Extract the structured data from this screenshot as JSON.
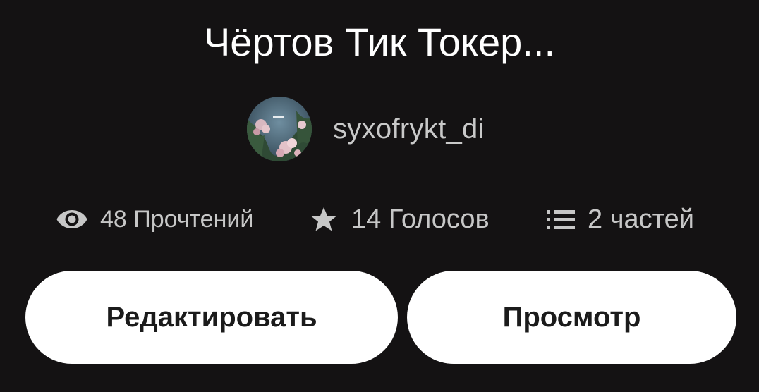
{
  "story": {
    "title": "Чёртов Тик Токер...",
    "author": {
      "username": "syxofrykt_di",
      "avatar_icon": "avatar-flowers-image"
    }
  },
  "stats": {
    "reads": {
      "icon": "eye-icon",
      "text": "48 Прочтений"
    },
    "votes": {
      "icon": "star-icon",
      "text": "14 Голосов"
    },
    "parts": {
      "icon": "list-icon",
      "text": "2 частей"
    }
  },
  "actions": {
    "edit_label": "Редактировать",
    "view_label": "Просмотр"
  },
  "colors": {
    "background": "#141213",
    "title_text": "#ffffff",
    "secondary_text": "#c7c7c7",
    "button_bg": "#ffffff",
    "button_text": "#1b1b1b"
  }
}
